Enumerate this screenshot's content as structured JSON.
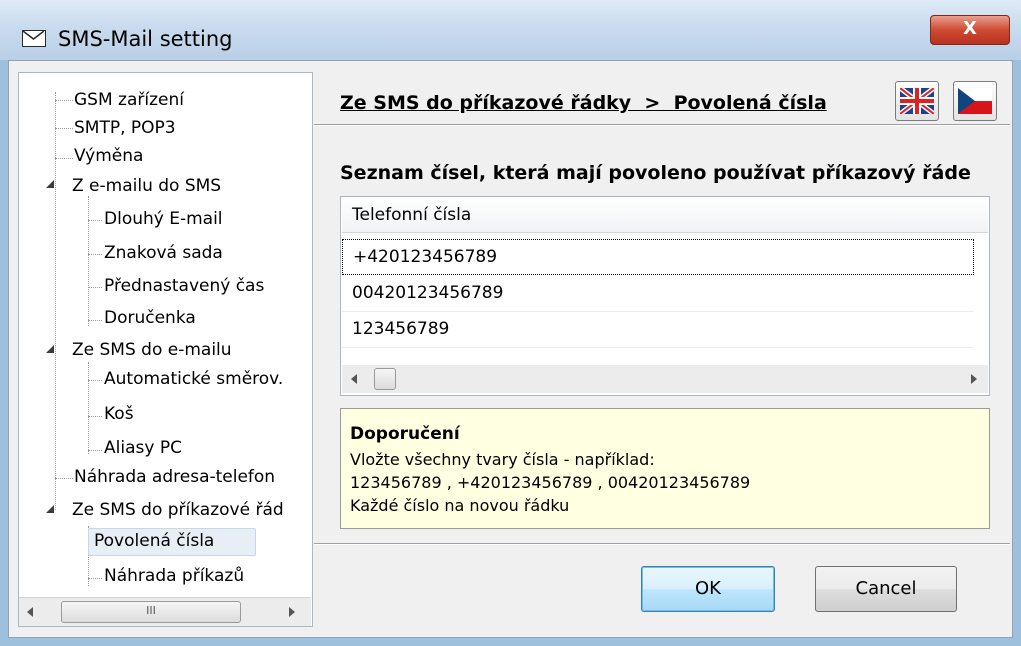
{
  "window": {
    "title": "SMS-Mail setting",
    "close_label": "X"
  },
  "tree": {
    "items": [
      {
        "label": "GSM zařízení"
      },
      {
        "label": "SMTP, POP3"
      },
      {
        "label": "Výměna"
      },
      {
        "label": "Z e-mailu do SMS"
      },
      {
        "label": "Dlouhý E-mail"
      },
      {
        "label": "Znaková sada"
      },
      {
        "label": "Přednastavený čas"
      },
      {
        "label": "Doručenka"
      },
      {
        "label": "Ze SMS do e-mailu"
      },
      {
        "label": "Automatické směrov."
      },
      {
        "label": "Koš"
      },
      {
        "label": "Aliasy PC"
      },
      {
        "label": "Náhrada adresa-telefon"
      },
      {
        "label": "Ze SMS do příkazové řád"
      },
      {
        "label": "Povolená čísla"
      },
      {
        "label": "Náhrada příkazů"
      }
    ],
    "selected": "Povolená čísla",
    "scroll_grip": "III"
  },
  "panel": {
    "breadcrumb": "Ze SMS do příkazové řádky  >  Povolená čísla",
    "heading": "Seznam čísel, která mají povoleno používat příkazový řáde",
    "list": {
      "column_header": "Telefonní čísla",
      "rows": [
        "+420123456789",
        "00420123456789",
        "123456789"
      ]
    },
    "tip": {
      "title": "Doporučení",
      "lines": [
        "Vložte všechny tvary čísla - například:",
        "123456789 , +420123456789 , 00420123456789",
        "Každé číslo na novou řádku"
      ]
    },
    "languages": [
      "english-flag-icon",
      "czech-flag-icon"
    ]
  },
  "buttons": {
    "ok": "OK",
    "cancel": "Cancel"
  },
  "colors": {
    "tip_background": "#ffffe1",
    "titlebar": "#c9dbee",
    "close_button": "#cf4a32"
  }
}
